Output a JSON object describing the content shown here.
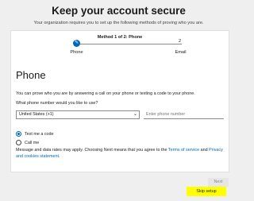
{
  "header": {
    "title": "Keep your account secure",
    "subtitle": "Your organization requires you to set up the following methods of proving who you are."
  },
  "progress": {
    "method_title": "Method 1 of 2: Phone",
    "step1_label": "Phone",
    "step2_number": "2",
    "step2_label": "Email"
  },
  "phone_section": {
    "title": "Phone",
    "intro": "You can prove who you are by answering a call on your phone or texting a code to your phone.",
    "question": "What phone number would you like to use?",
    "country_value": "United States (+1)",
    "phone_placeholder": "Enter phone number",
    "option_text": "Text me a code",
    "option_call": "Call me",
    "disclaimer_pre": "Message and data rates may apply. Choosing Next means that you agree to the ",
    "terms_link": "Terms of service",
    "disclaimer_and": " and ",
    "privacy_link": "Privacy and cookies statement",
    "disclaimer_end": "."
  },
  "actions": {
    "next_label": "Next",
    "skip_label": "Skip setup"
  },
  "colors": {
    "accent": "#0067b8",
    "highlight": "#ffff00"
  }
}
